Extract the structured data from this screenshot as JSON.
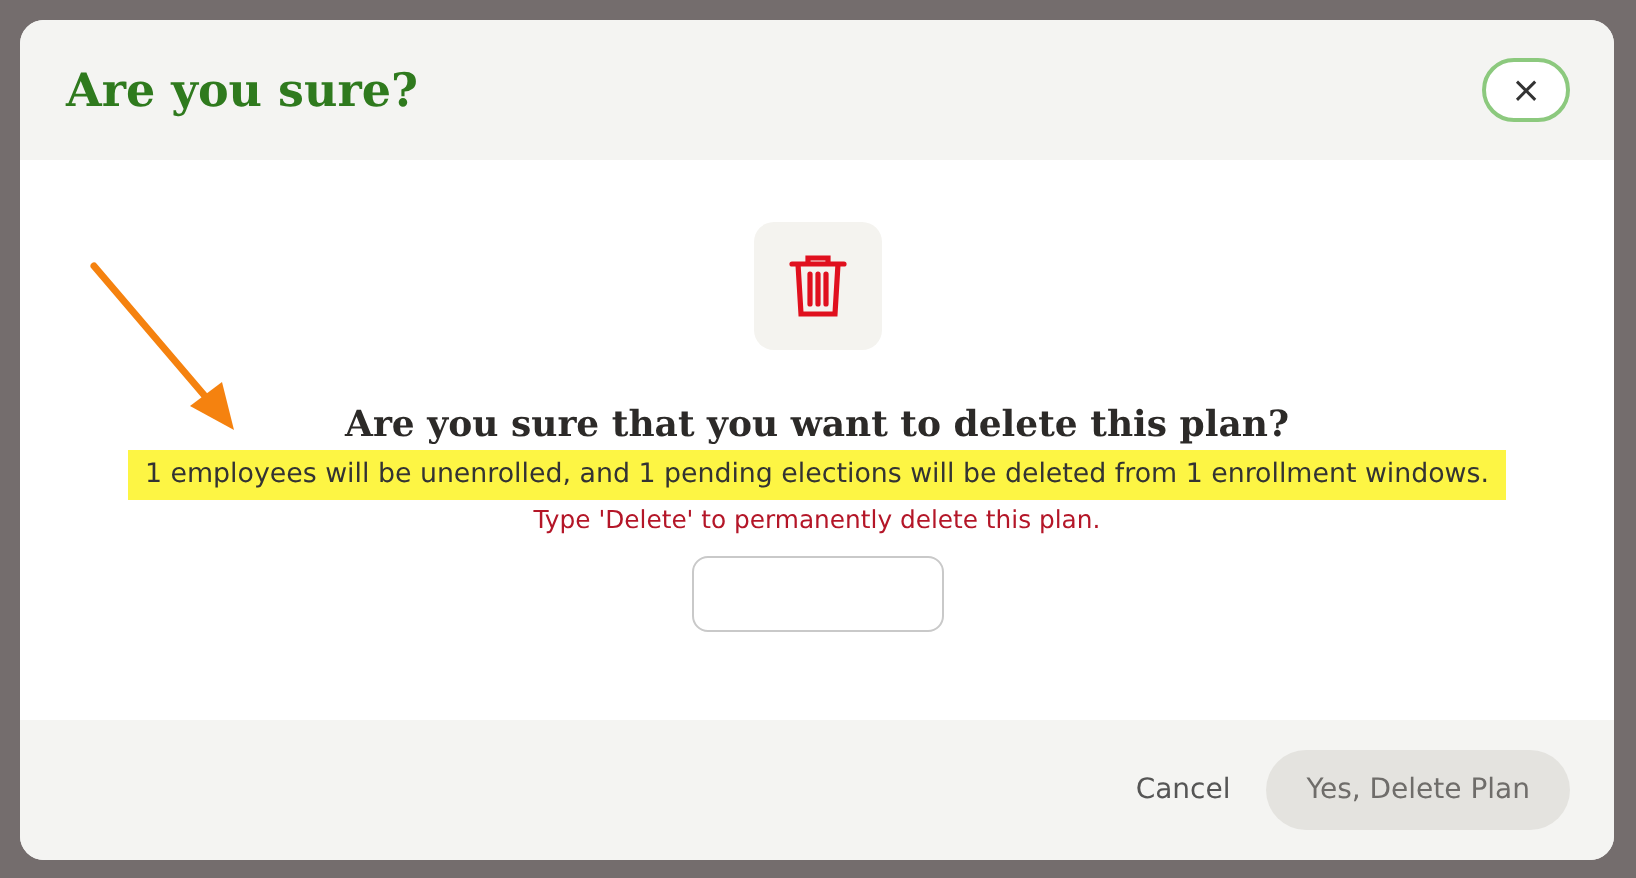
{
  "dialog": {
    "title": "Are you sure?",
    "close": "×"
  },
  "body": {
    "heading": "Are you sure that you want to delete this plan?",
    "impact": "1 employees will be unenrolled, and 1 pending elections will be deleted from 1 enrollment windows.",
    "impact_highlighted": true,
    "instruction": "Type 'Delete' to permanently delete this plan."
  },
  "buttons": [
    {
      "kind": "text",
      "label": "Cancel",
      "disabled": false
    },
    {
      "kind": "primary",
      "label": "Yes, Delete Plan",
      "disabled": true
    }
  ]
}
